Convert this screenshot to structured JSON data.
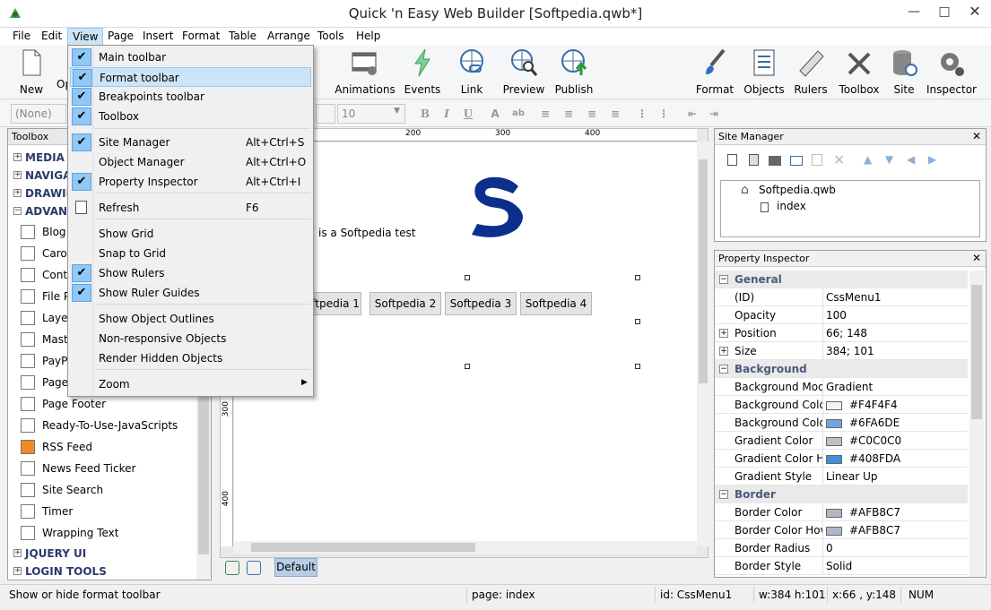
{
  "window": {
    "title": "Quick 'n Easy Web Builder [Softpedia.qwb*]"
  },
  "menubar": [
    "File",
    "Edit",
    "View",
    "Page",
    "Insert",
    "Format",
    "Table",
    "Arrange",
    "Tools",
    "Help"
  ],
  "toolbar": {
    "new": "New",
    "open_partial": "Op",
    "animations": "Animations",
    "events": "Events",
    "link": "Link",
    "preview": "Preview",
    "publish": "Publish",
    "format": "Format",
    "objects": "Objects",
    "rulers": "Rulers",
    "toolbox": "Toolbox",
    "site": "Site",
    "inspector": "Inspector"
  },
  "formatbar": {
    "style_value": "(None)",
    "size_value": "10",
    "bold": "B",
    "italic": "I",
    "underline": "U"
  },
  "view_menu": {
    "items": [
      {
        "label": "Main toolbar",
        "checked": true,
        "shortcut": ""
      },
      {
        "label": "Format toolbar",
        "checked": true,
        "shortcut": "",
        "highlighted": true
      },
      {
        "label": "Breakpoints toolbar",
        "checked": true,
        "shortcut": ""
      },
      {
        "label": "Toolbox",
        "checked": true,
        "shortcut": ""
      },
      {
        "label": "Site Manager",
        "checked": true,
        "shortcut": "Alt+Ctrl+S"
      },
      {
        "label": "Object Manager",
        "checked": false,
        "shortcut": "Alt+Ctrl+O"
      },
      {
        "label": "Property Inspector",
        "checked": true,
        "shortcut": "Alt+Ctrl+I"
      },
      {
        "label": "Refresh",
        "checked": false,
        "shortcut": "F6"
      },
      {
        "label": "Show Grid",
        "checked": false,
        "shortcut": ""
      },
      {
        "label": "Snap to Grid",
        "checked": false,
        "shortcut": ""
      },
      {
        "label": "Show Rulers",
        "checked": true,
        "shortcut": ""
      },
      {
        "label": "Show Ruler Guides",
        "checked": true,
        "shortcut": ""
      },
      {
        "label": "Show Object Outlines",
        "checked": false,
        "shortcut": ""
      },
      {
        "label": "Non-responsive Objects",
        "checked": false,
        "shortcut": ""
      },
      {
        "label": "Render Hidden Objects",
        "checked": false,
        "shortcut": ""
      },
      {
        "label": "Zoom",
        "checked": false,
        "shortcut": "",
        "submenu": true
      }
    ]
  },
  "toolbox": {
    "title": "Toolbox",
    "categories_top": [
      "MEDIA",
      "NAVIGATION",
      "DRAWING",
      "ADVANCED"
    ],
    "items": [
      "Blog",
      "Carousel",
      "Contact",
      "File Publisher",
      "Layer",
      "Master",
      "PayPal",
      "Page",
      "Page Footer",
      "Ready-To-Use-JavaScripts",
      "RSS Feed",
      "News Feed Ticker",
      "Site Search",
      "Timer",
      "Wrapping Text"
    ],
    "categories_bottom": [
      "JQUERY UI",
      "LOGIN TOOLS"
    ]
  },
  "canvas": {
    "ruler_marks": [
      "200",
      "300",
      "400"
    ],
    "ruler_left_marks": [
      "300",
      "400"
    ],
    "text": "is a Softpedia test",
    "menu_buttons": [
      "oftpedia 1",
      "Softpedia 2",
      "Softpedia 3",
      "Softpedia 4"
    ],
    "bottom_tab": "Default"
  },
  "site_manager": {
    "title": "Site Manager",
    "root": "Softpedia.qwb",
    "child": "index"
  },
  "property_inspector": {
    "title": "Property Inspector",
    "rows": [
      {
        "type": "cat",
        "key": "General"
      },
      {
        "key": "(ID)",
        "value": "CssMenu1"
      },
      {
        "key": "Opacity",
        "value": "100"
      },
      {
        "key": "Position",
        "value": "66; 148",
        "expand": true
      },
      {
        "key": "Size",
        "value": "384; 101",
        "expand": true
      },
      {
        "type": "cat",
        "key": "Background"
      },
      {
        "key": "Background Mode",
        "value": "Gradient"
      },
      {
        "key": "Background Color",
        "value": "#F4F4F4",
        "swatch": "#F4F4F4"
      },
      {
        "key": "Background Color Hover",
        "value": "#6FA6DE",
        "swatch": "#6FA6DE"
      },
      {
        "key": "Gradient Color",
        "value": "#C0C0C0",
        "swatch": "#C0C0C0"
      },
      {
        "key": "Gradient Color Hover",
        "value": "#408FDA",
        "swatch": "#408FDA"
      },
      {
        "key": "Gradient Style",
        "value": "Linear Up"
      },
      {
        "type": "cat",
        "key": "Border"
      },
      {
        "key": "Border Color",
        "value": "#AFB8C7",
        "swatch": "#AFB8C7"
      },
      {
        "key": "Border Color Hover",
        "value": "#AFB8C7",
        "swatch": "#AFB8C7"
      },
      {
        "key": "Border Radius",
        "value": "0"
      },
      {
        "key": "Border Style",
        "value": "Solid"
      }
    ]
  },
  "statusbar": {
    "hint": "Show or hide format toolbar",
    "page": "page: index",
    "id": "id: CssMenu1",
    "size": "w:384 h:101",
    "pos": "x:66 , y:148",
    "num": "NUM"
  },
  "colors": {
    "accent": "#0c2f8c",
    "highlight": "#cce4f7",
    "check": "#90c8f6"
  }
}
